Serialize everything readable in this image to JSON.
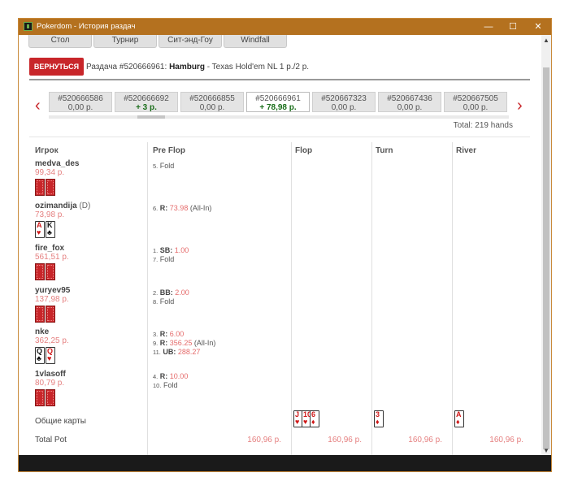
{
  "window": {
    "title": "Pokerdom - История раздач",
    "minimize": "—",
    "maximize": "☐",
    "close": "✕"
  },
  "filter_tabs": [
    "Стол",
    "Турнир",
    "Сит-энд-Гоу",
    "Windfall"
  ],
  "back_button": "ВЕРНУТЬСЯ",
  "hand_info": {
    "prefix": "Раздача #520666961:",
    "table": "Hamburg",
    "suffix": " - Texas Hold'em NL  1 р./2 р."
  },
  "hands": [
    {
      "id": "#520666586",
      "amount": "0,00 р.",
      "positive": false,
      "active": false
    },
    {
      "id": "#520666692",
      "amount": "+ 3 р.",
      "positive": true,
      "active": false
    },
    {
      "id": "#520666855",
      "amount": "0,00 р.",
      "positive": false,
      "active": false
    },
    {
      "id": "#520666961",
      "amount": "+ 78,98 р.",
      "positive": true,
      "active": true
    },
    {
      "id": "#520667323",
      "amount": "0,00 р.",
      "positive": false,
      "active": false
    },
    {
      "id": "#520667436",
      "amount": "0,00 р.",
      "positive": false,
      "active": false
    },
    {
      "id": "#520667505",
      "amount": "0,00 р.",
      "positive": false,
      "active": false
    }
  ],
  "nav": {
    "prev": "‹",
    "next": "›"
  },
  "total_hands": "Total: 219 hands",
  "columns": {
    "player": "Игрок",
    "preflop": "Pre Flop",
    "flop": "Flop",
    "turn": "Turn",
    "river": "River"
  },
  "players": [
    {
      "name": "medva_des",
      "dealer": "",
      "balance": "99,34 р.",
      "cards": "hidden",
      "actions": [
        {
          "n": "5.",
          "label": "",
          "amount": "",
          "text": "Fold"
        }
      ]
    },
    {
      "name": "ozimandija",
      "dealer": "(D)",
      "balance": "73,98 р.",
      "cards": [
        {
          "r": "A",
          "s": "♥",
          "c": "red"
        },
        {
          "r": "K",
          "s": "♣",
          "c": "blk"
        }
      ],
      "actions": [
        {
          "n": "6.",
          "label": "R:",
          "amount": "73.98",
          "text": "(All-In)"
        }
      ]
    },
    {
      "name": "fire_fox",
      "dealer": "",
      "balance": "561,51 р.",
      "cards": "hidden",
      "actions": [
        {
          "n": "1.",
          "label": "SB:",
          "amount": "1.00",
          "text": ""
        },
        {
          "n": "7.",
          "label": "",
          "amount": "",
          "text": "Fold"
        }
      ]
    },
    {
      "name": "yuryev95",
      "dealer": "",
      "balance": "137,98 р.",
      "cards": "hidden",
      "actions": [
        {
          "n": "2.",
          "label": "BB:",
          "amount": "2.00",
          "text": ""
        },
        {
          "n": "8.",
          "label": "",
          "amount": "",
          "text": "Fold"
        }
      ]
    },
    {
      "name": "nke",
      "dealer": "",
      "balance": "362,25 р.",
      "cards": [
        {
          "r": "Q",
          "s": "♣",
          "c": "blk"
        },
        {
          "r": "Q",
          "s": "♥",
          "c": "red"
        }
      ],
      "actions": [
        {
          "n": "3.",
          "label": "R:",
          "amount": "6.00",
          "text": ""
        },
        {
          "n": "9.",
          "label": "R:",
          "amount": "356.25",
          "text": "(All-In)"
        },
        {
          "n": "11.",
          "label": "UB:",
          "amount": "288.27",
          "text": ""
        }
      ]
    },
    {
      "name": "1vlasoff",
      "dealer": "",
      "balance": "80,79 р.",
      "cards": "hidden",
      "actions": [
        {
          "n": "4.",
          "label": "R:",
          "amount": "10.00",
          "text": ""
        },
        {
          "n": "10.",
          "label": "",
          "amount": "",
          "text": "Fold"
        }
      ]
    }
  ],
  "community": {
    "label": "Общие карты",
    "flop": [
      {
        "r": "J",
        "s": "♥",
        "c": "red"
      },
      {
        "r": "10",
        "s": "♥",
        "c": "red"
      },
      {
        "r": "6",
        "s": "♦",
        "c": "red"
      }
    ],
    "turn": [
      {
        "r": "3",
        "s": "♦",
        "c": "red"
      }
    ],
    "river": [
      {
        "r": "A",
        "s": "♦",
        "c": "red"
      }
    ]
  },
  "total_pot": {
    "label": "Total Pot",
    "preflop": "160,96 р.",
    "flop": "160,96 р.",
    "turn": "160,96 р.",
    "river": "160,96 р."
  },
  "scroll": {
    "up": "▲",
    "down": "▼"
  }
}
